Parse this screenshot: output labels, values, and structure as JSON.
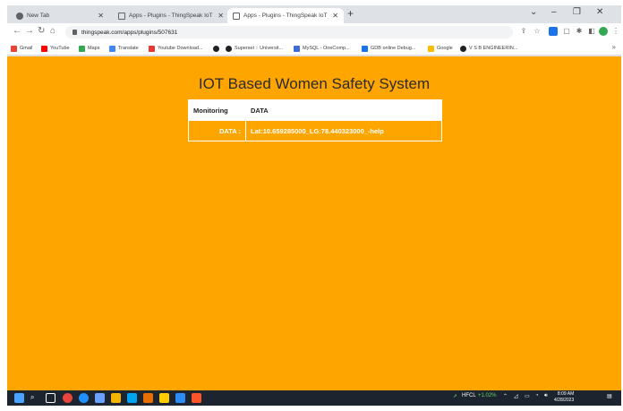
{
  "tabs": [
    {
      "label": "New Tab",
      "active": false
    },
    {
      "label": "Apps - Plugins - ThingSpeak IoT",
      "active": false
    },
    {
      "label": "Apps - Plugins - ThingSpeak IoT",
      "active": true
    }
  ],
  "address": {
    "url": "thingspeak.com/apps/plugins/507631"
  },
  "bookmarks": [
    {
      "label": "Gmail",
      "color": "#ea4335"
    },
    {
      "label": "YouTube",
      "color": "#ff0000"
    },
    {
      "label": "Maps",
      "color": "#34a853"
    },
    {
      "label": "Translate",
      "color": "#4285f4"
    },
    {
      "label": "Youtube Download...",
      "color": "#e53935"
    },
    {
      "label": "",
      "color": "#202124"
    },
    {
      "label": "Superset :: Universit...",
      "color": "#202124"
    },
    {
      "label": "MySQL - OneComp...",
      "color": "#3f6ad8"
    },
    {
      "label": "GDB online Debug...",
      "color": "#1a73e8"
    },
    {
      "label": "Google",
      "color": "#fbbc04"
    },
    {
      "label": "V S B ENGINEERIN...",
      "color": "#202124"
    }
  ],
  "page": {
    "title": "IOT Based Women Safety System",
    "table": {
      "header": [
        "Monitoring",
        "DATA"
      ],
      "row_key": "DATA :",
      "row_value": "Lat:10.659285000_LG:78.440323000_-help"
    }
  },
  "taskbar": {
    "stock": "HFCL",
    "change": "+1.02%",
    "time": "8:09 AM",
    "date": "4/28/2023"
  },
  "colors": {
    "page_bg": "#ffa500",
    "taskbar_bg": "#1c2430",
    "chrome_bg": "#dee1e6"
  }
}
